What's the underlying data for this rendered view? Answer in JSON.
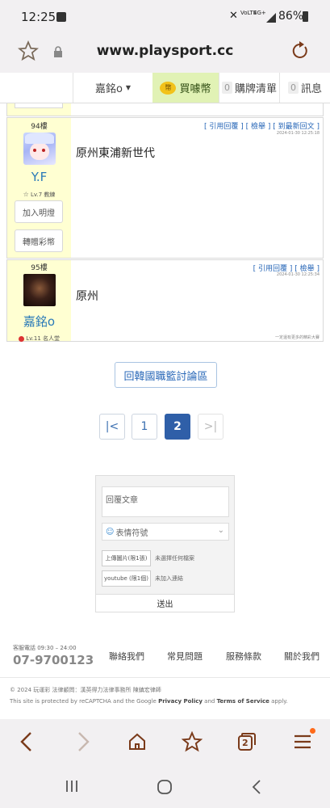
{
  "status_bar": {
    "time": "12:25",
    "network_labels": [
      "VoLTE",
      "4G+"
    ],
    "battery": "86%"
  },
  "url_bar": {
    "url": "www.playsport.cc"
  },
  "site_nav": {
    "user": "嘉銘o",
    "buy_coins": "買噱幣",
    "coin_badge": "幣",
    "cart_count": "0",
    "cart_label": "購牌清單",
    "msg_count": "0",
    "msg_label": "訊息"
  },
  "posts": [
    {
      "floor": "94樓",
      "username": "Y.F",
      "level": "Lv.7 教練",
      "actions": [
        "[ 引用回覆 ]",
        "[ 檢舉 ]",
        "[ 到最新回文 ]"
      ],
      "timestamp": "2024-01-30 12:25:18",
      "content": "原州東浦新世代",
      "buttons": [
        "加入明燈",
        "轉贈彩幣"
      ]
    },
    {
      "floor": "95樓",
      "username": "嘉銘o",
      "level": "Lv.11 名人堂",
      "actions": [
        "[ 引用回覆 ]",
        "[ 檢舉 ]"
      ],
      "timestamp": "2024-01-30 12:25:34",
      "content": "原州",
      "footer_note": "一定還有更多的精彩大賽"
    }
  ],
  "back_button": "回韓國職籃討論區",
  "pagination": {
    "first": "|<",
    "pages": [
      "1",
      "2"
    ],
    "current": "2",
    "last": ">|"
  },
  "reply_form": {
    "placeholder": "回覆文章",
    "emoji_label": "表情符號",
    "upload_button": "上傳圖片(限1張)",
    "upload_status": "未選擇任何檔案",
    "youtube_button": "youtube (限1個)",
    "youtube_status": "未加入連結",
    "submit": "送出"
  },
  "footer": {
    "service_hours": "客服電話 09:30 – 24:00",
    "phone": "07-9700123",
    "links": [
      "聯絡我們",
      "常見問題",
      "服務條款",
      "關於我們"
    ],
    "copyright": "© 2024 玩運彩  法律顧問：漢英得力法律事務所 陳鎮宏律師",
    "recaptcha_prefix": "This site is protected by reCAPTCHA and the Google ",
    "privacy": "Privacy Policy",
    "and": " and ",
    "terms": "Terms of Service",
    "apply": " apply."
  },
  "browser_bar": {
    "tab_count": "2"
  },
  "colors": {
    "accent_blue": "#2a7ab8",
    "active_page": "#2f5fa8",
    "coin_bg": "#e1f2b5",
    "user_panel": "#ffffd2",
    "menu_dot": "#ff6a1a"
  }
}
